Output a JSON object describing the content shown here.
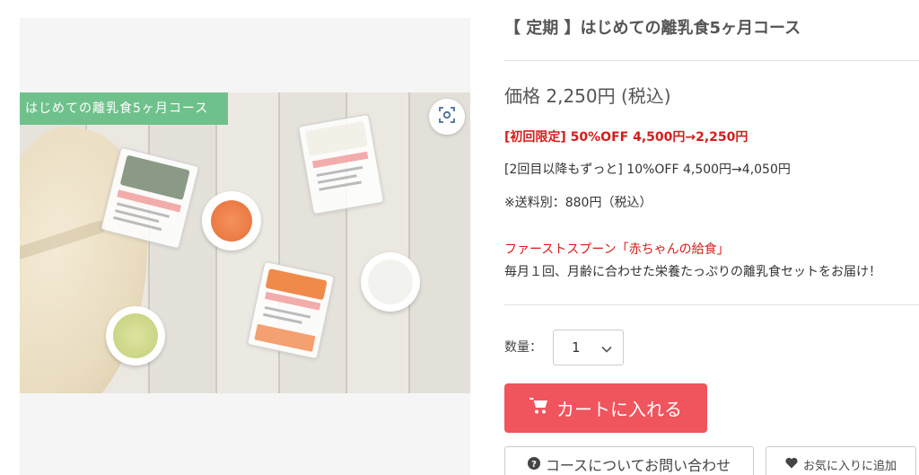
{
  "product": {
    "image_banner": "はじめての離乳食5ヶ月コース",
    "title": "【 定期 】はじめての離乳食5ヶ月コース",
    "price": "価格 2,250円 (税込)",
    "first_time_offer": "[初回限定] 50%OFF 4,500円→2,250円",
    "subsequent_offer": "[2回目以降もずっと] 10%OFF 4,500円→4,050円",
    "shipping": "※送料別：880円（税込）",
    "brand_line": "ファーストスプーン「赤ちゃんの給食」",
    "description": "毎月１回、月齢に合わせた栄養たっぷりの離乳食セットをお届け！"
  },
  "quantity": {
    "label": "数量：",
    "value": "1"
  },
  "actions": {
    "add_to_cart": "カートに入れる",
    "inquiry": "コースについてお問い合わせ",
    "favorite": "お気に入りに追加"
  },
  "icons": {
    "zoom": "zoom-icon",
    "cart": "cart-icon",
    "question": "question-circle-icon",
    "heart": "heart-icon",
    "chevron": "chevron-down-icon"
  },
  "colors": {
    "accent_red": "#d71b1b",
    "cart_button": "#f0545c",
    "banner_green": "#6fc18c"
  }
}
